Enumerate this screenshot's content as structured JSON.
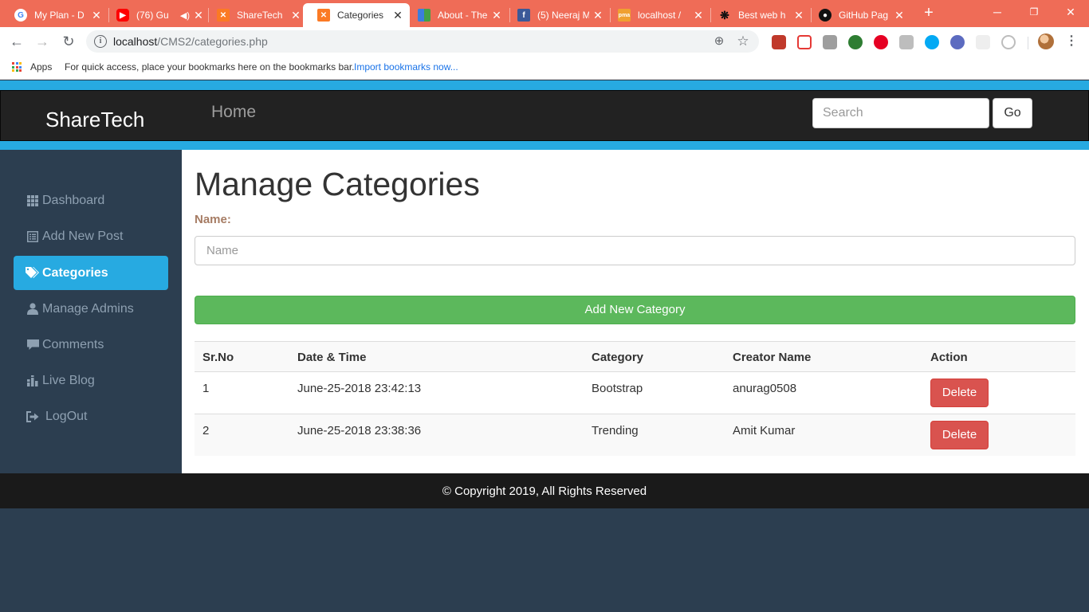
{
  "browser": {
    "tabs": [
      {
        "title": "My Plan - D",
        "icon": "google-icon",
        "active": false
      },
      {
        "title": "(76) Gu",
        "icon": "youtube-icon",
        "active": false,
        "audio": true
      },
      {
        "title": "ShareTech",
        "icon": "xampp-icon",
        "active": false
      },
      {
        "title": "Categories",
        "icon": "xampp-icon",
        "active": true
      },
      {
        "title": "About - The",
        "icon": "grid-icon",
        "active": false
      },
      {
        "title": "(5) Neeraj M",
        "icon": "facebook-icon",
        "active": false
      },
      {
        "title": "localhost /",
        "icon": "phpmyadmin-icon",
        "active": false
      },
      {
        "title": "Best web h",
        "icon": "paw-icon",
        "active": false
      },
      {
        "title": "GitHub Pag",
        "icon": "github-icon",
        "active": false
      }
    ],
    "close_glyph": "✕",
    "new_tab_glyph": "+",
    "url_host": "localhost",
    "url_path": "/CMS2/categories.php",
    "bookmarks": {
      "apps_label": "Apps",
      "hint": "For quick access, place your bookmarks here on the bookmarks bar.",
      "import_link": "Import bookmarks now..."
    }
  },
  "site": {
    "brand": "ShareTech",
    "nav_home": "Home",
    "search_placeholder": "Search",
    "go_label": "Go"
  },
  "sidebar": {
    "items": [
      {
        "label": "Dashboard",
        "icon": "th-icon",
        "active": false
      },
      {
        "label": "Add New Post",
        "icon": "list-alt-icon",
        "active": false
      },
      {
        "label": "Categories",
        "icon": "tags-icon",
        "active": true
      },
      {
        "label": "Manage Admins",
        "icon": "user-icon",
        "active": false
      },
      {
        "label": "Comments",
        "icon": "comment-icon",
        "active": false
      },
      {
        "label": "Live Blog",
        "icon": "equalizer-icon",
        "active": false
      },
      {
        "label": "LogOut",
        "icon": "log-out-icon",
        "active": false
      }
    ]
  },
  "main": {
    "title": "Manage Categories",
    "name_label": "Name:",
    "name_placeholder": "Name",
    "add_button": "Add New Category",
    "table": {
      "headers": [
        "Sr.No",
        "Date & Time",
        "Category",
        "Creator Name",
        "Action"
      ],
      "rows": [
        {
          "sr": "1",
          "datetime": "June-25-2018 23:42:13",
          "category": "Bootstrap",
          "creator": "anurag0508",
          "action": "Delete"
        },
        {
          "sr": "2",
          "datetime": "June-25-2018 23:38:36",
          "category": "Trending",
          "creator": "Amit Kumar",
          "action": "Delete"
        }
      ]
    }
  },
  "footer": {
    "text": "© Copyright 2019, All Rights Reserved"
  },
  "colors": {
    "chrome_tabstrip": "#ef6c57",
    "accent_blue": "#27aae1",
    "navbar": "#222222",
    "sidebar": "#2c3e50",
    "success": "#5cb85c",
    "danger": "#d9534f",
    "label_brown": "#a67c64"
  }
}
